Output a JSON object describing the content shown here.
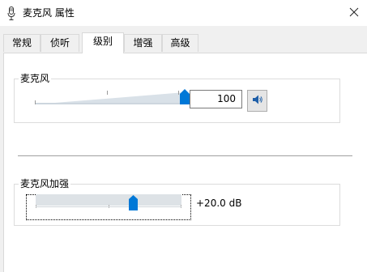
{
  "window": {
    "title": "麦克风 属性",
    "title_icon": "microphone-icon",
    "close_icon": "close-icon"
  },
  "tabs": [
    {
      "label": "常规",
      "active": false
    },
    {
      "label": "侦听",
      "active": false
    },
    {
      "label": "级别",
      "active": true
    },
    {
      "label": "增强",
      "active": false
    },
    {
      "label": "高级",
      "active": false
    }
  ],
  "microphone_group": {
    "label": "麦克风",
    "level_value": "100",
    "level_fraction": 1.0,
    "speaker_icon": "speaker-icon"
  },
  "boost_group": {
    "label": "麦克风加强",
    "value_text": "+20.0 dB",
    "boost_fraction": 0.667
  },
  "colors": {
    "accent": "#0078d7",
    "panel": "#ffffff",
    "window_bg": "#f0f0f0"
  }
}
